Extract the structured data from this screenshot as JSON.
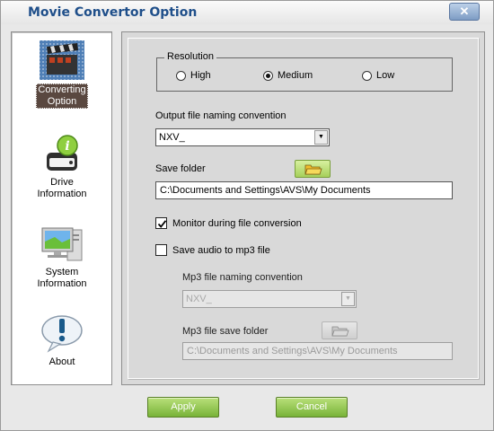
{
  "window": {
    "title": "Movie Convertor Option",
    "close_glyph": "✕"
  },
  "sidebar": {
    "items": [
      {
        "label_lines": [
          "Converting",
          "Option"
        ],
        "icon": "film-clapper-icon",
        "active": true
      },
      {
        "label_lines": [
          "Drive",
          "Information"
        ],
        "icon": "drive-info-icon",
        "active": false
      },
      {
        "label_lines": [
          "System",
          "Information"
        ],
        "icon": "computer-icon",
        "active": false
      },
      {
        "label_lines": [
          "About"
        ],
        "icon": "speech-exclamation-icon",
        "active": false
      }
    ]
  },
  "resolution": {
    "legend": "Resolution",
    "options": [
      {
        "label": "High",
        "checked": false
      },
      {
        "label": "Medium",
        "checked": true
      },
      {
        "label": "Low",
        "checked": false
      }
    ]
  },
  "output_naming": {
    "label": "Output file naming convention",
    "value": "NXV_"
  },
  "save_folder": {
    "label": "Save folder",
    "value": "C:\\Documents and Settings\\AVS\\My Documents",
    "icon": "folder-open-icon"
  },
  "monitor": {
    "label": "Monitor during file conversion",
    "checked": true
  },
  "save_audio": {
    "label": "Save audio to mp3 file",
    "checked": false
  },
  "mp3_naming": {
    "label": "Mp3 file naming convention",
    "value": "NXV_",
    "disabled": true
  },
  "mp3_folder": {
    "label": "Mp3 file save folder",
    "value": "C:\\Documents and Settings\\AVS\\My Documents",
    "disabled": true,
    "icon": "folder-open-icon"
  },
  "buttons": {
    "apply": "Apply",
    "cancel": "Cancel"
  },
  "colors": {
    "title": "#1f4f8a",
    "button_green": "#78b338",
    "active_label_bg": "#5a4840"
  }
}
